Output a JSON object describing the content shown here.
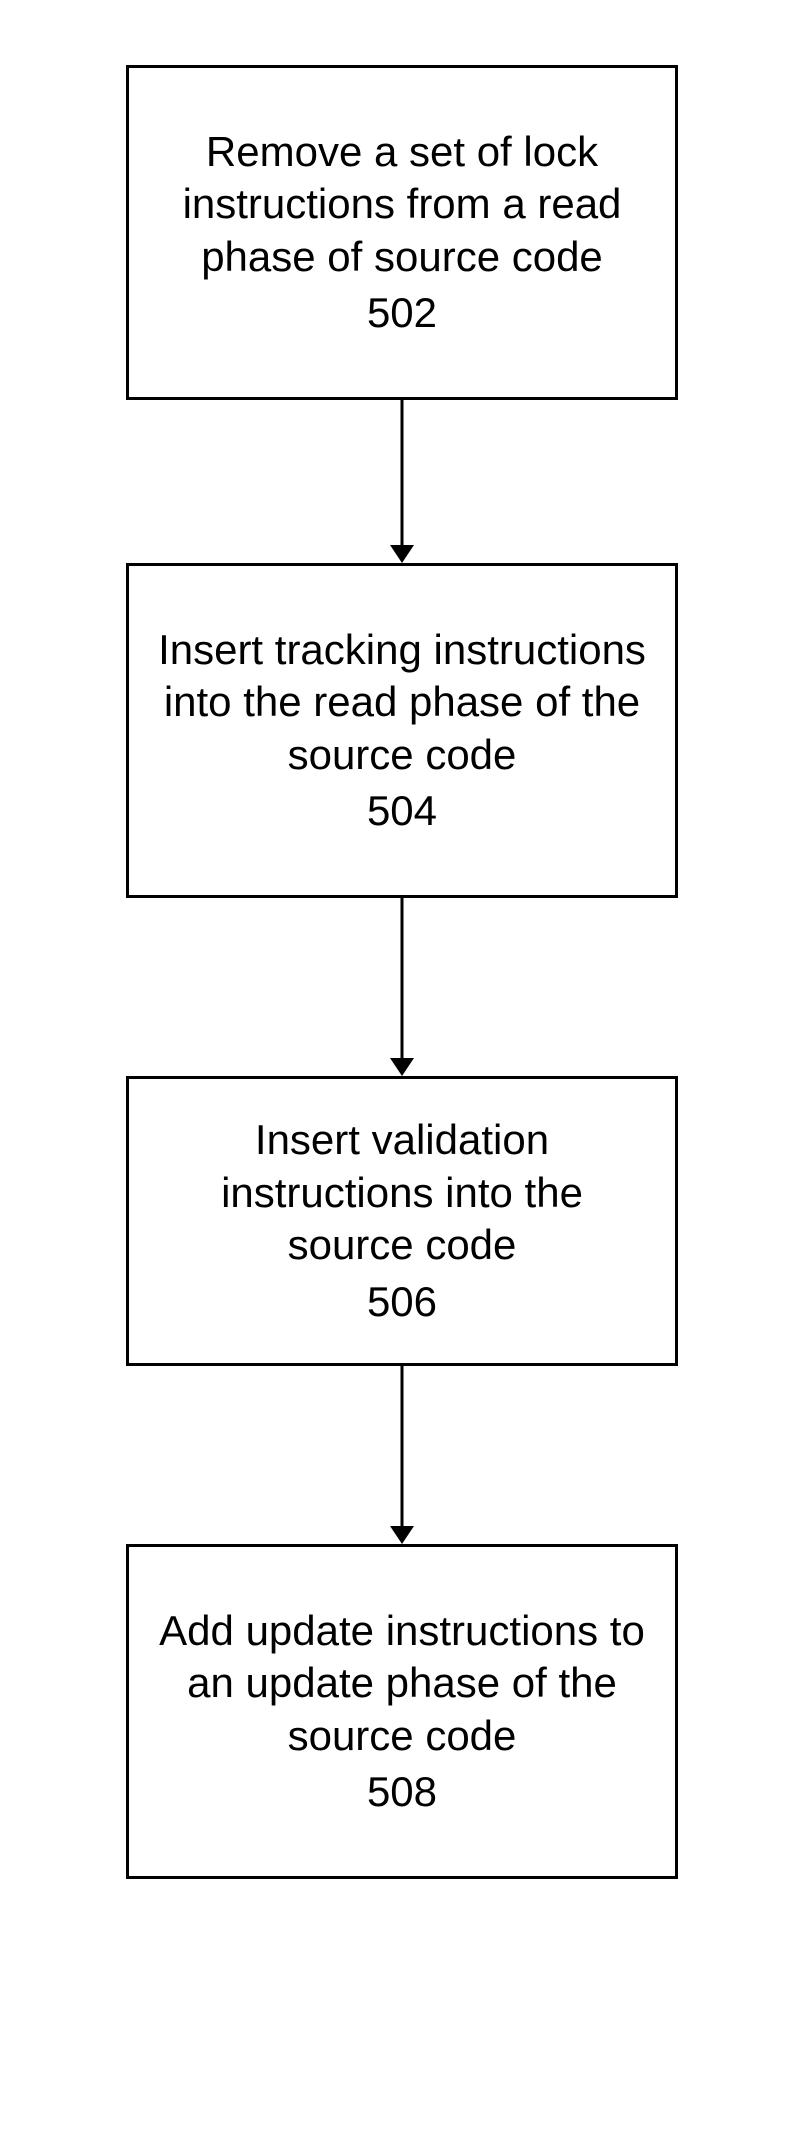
{
  "flowchart": {
    "steps": [
      {
        "text": "Remove a set of lock instructions from a read phase of source code",
        "number": "502"
      },
      {
        "text": "Insert tracking instructions into the read phase of the source code",
        "number": "504"
      },
      {
        "text": "Insert validation instructions into the source code",
        "number": "506"
      },
      {
        "text": "Add update instructions to an update phase of the source code",
        "number": "508"
      }
    ]
  }
}
